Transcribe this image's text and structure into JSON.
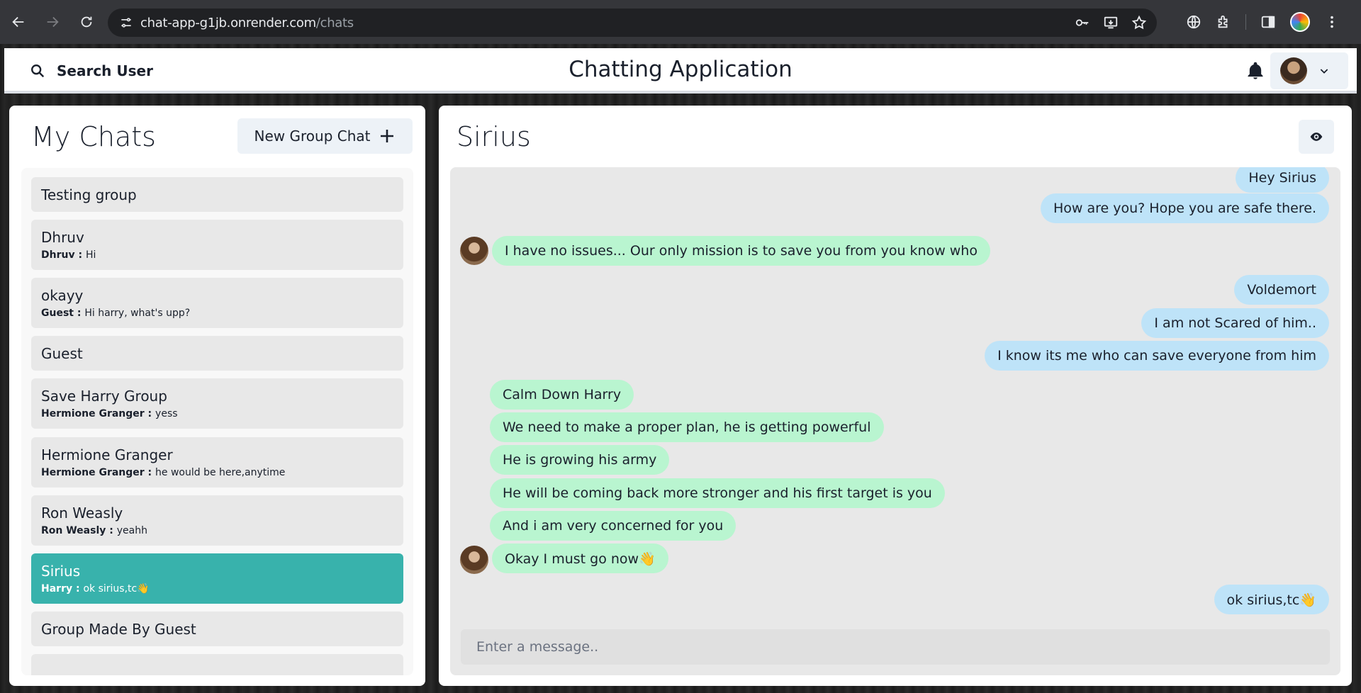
{
  "browser": {
    "url_host": "chat-app-g1jb.onrender.com",
    "url_path": "/chats"
  },
  "header": {
    "search_label": "Search User",
    "title": "Chatting Application"
  },
  "chats_panel": {
    "title": "My Chats",
    "new_group_label": "New Group Chat",
    "items": [
      {
        "name": "Testing group",
        "sender": "",
        "latest": ""
      },
      {
        "name": "Dhruv",
        "sender": "Dhruv : ",
        "latest": "Hi"
      },
      {
        "name": "okayy",
        "sender": "Guest : ",
        "latest": "Hi harry, what's upp?"
      },
      {
        "name": "Guest",
        "sender": "",
        "latest": ""
      },
      {
        "name": "Save Harry Group",
        "sender": "Hermione Granger : ",
        "latest": "yess"
      },
      {
        "name": "Hermione Granger",
        "sender": "Hermione Granger : ",
        "latest": "he would be here,anytime"
      },
      {
        "name": "Ron Weasly",
        "sender": "Ron Weasly : ",
        "latest": "yeahh"
      },
      {
        "name": "Sirius",
        "sender": "Harry : ",
        "latest": "ok sirius,tc👋",
        "active": true
      },
      {
        "name": "Group Made By Guest",
        "sender": "",
        "latest": ""
      }
    ]
  },
  "conversation": {
    "title": "Sirius",
    "input_placeholder": "Enter a message..",
    "messages": [
      {
        "text": "Hey Sirius",
        "side": "sent"
      },
      {
        "text": "How are you? Hope you are safe there.",
        "side": "sent"
      },
      {
        "text": "I have no issues... Our only mission is to save you from you know who",
        "side": "recv",
        "avatar": true
      },
      {
        "text": "Voldemort",
        "side": "sent"
      },
      {
        "text": "I am not Scared of him..",
        "side": "sent"
      },
      {
        "text": "I know its me who can save everyone from him",
        "side": "sent"
      },
      {
        "text": "Calm Down Harry",
        "side": "recv"
      },
      {
        "text": "We need to make a proper plan, he is getting powerful",
        "side": "recv"
      },
      {
        "text": "He is growing his army",
        "side": "recv"
      },
      {
        "text": "He will be coming back more stronger and his first target is you",
        "side": "recv"
      },
      {
        "text": "And i am very concerned for you",
        "side": "recv"
      },
      {
        "text": "Okay I must go now👋",
        "side": "recv",
        "avatar": true
      },
      {
        "text": "ok sirius,tc👋",
        "side": "sent"
      }
    ]
  },
  "colors": {
    "accent": "#38b2ac",
    "sent_bubble": "#bee3f8",
    "recv_bubble": "#b9f5d0"
  }
}
